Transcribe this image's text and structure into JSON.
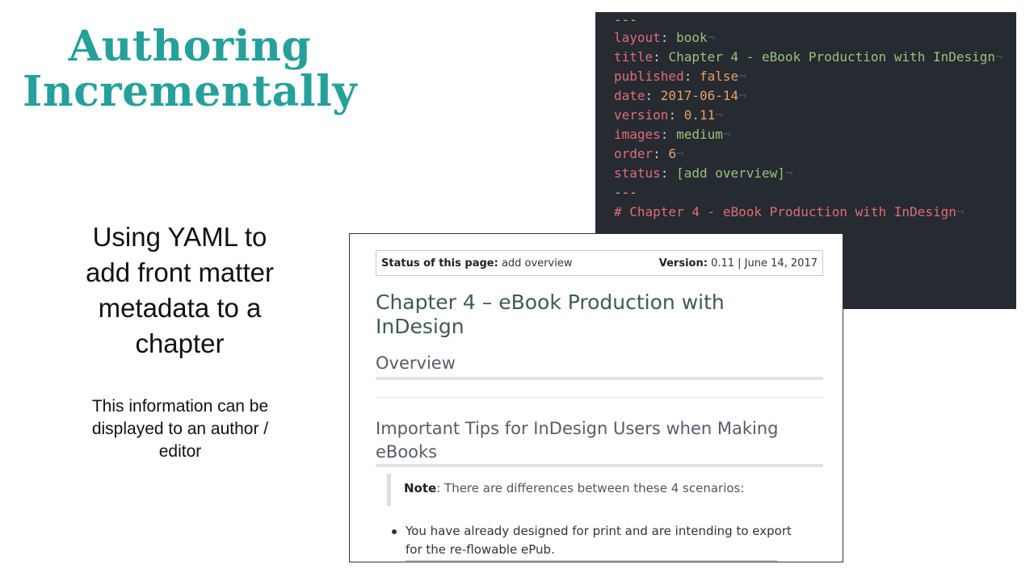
{
  "slide": {
    "title_line1": "Authoring",
    "title_line2": "Incrementally",
    "subtitle_line1": "Using YAML to",
    "subtitle_line2": "add front matter",
    "subtitle_line3": "metadata to a",
    "subtitle_line4": "chapter",
    "caption_line1": "This information can be",
    "caption_line2": "displayed to an author /",
    "caption_line3": "editor",
    "accent_color": "#26a09a"
  },
  "editor": {
    "delimiter": "---",
    "eol_marker": "¬",
    "lines": [
      {
        "key": "layout",
        "value": "book",
        "kind": "string"
      },
      {
        "key": "title",
        "value": "Chapter 4 - eBook Production with InDesign",
        "kind": "string"
      },
      {
        "key": "published",
        "value": "false",
        "kind": "number"
      },
      {
        "key": "date",
        "value": "2017-06-14",
        "kind": "number"
      },
      {
        "key": "version",
        "value": "0.11",
        "kind": "number"
      },
      {
        "key": "images",
        "value": "medium",
        "kind": "string"
      },
      {
        "key": "order",
        "value": "6",
        "kind": "number"
      },
      {
        "key": "status",
        "value": "[add overview]",
        "kind": "string"
      }
    ],
    "heading": "# Chapter 4 - eBook Production with InDesign",
    "background_color": "#262a31"
  },
  "page": {
    "status_label": "Status of this page:",
    "status_value": "add overview",
    "version_label": "Version:",
    "version_value": "0.11 | June 14, 2017",
    "chapter_title": "Chapter 4 – eBook Production with InDesign",
    "overview_heading": "Overview",
    "tips_heading": "Important Tips for InDesign Users when Making eBooks",
    "note_label": "Note",
    "note_text": ": There are differences between these 4 scenarios:",
    "bullet1": "You have already designed for print and are intending to export for the re-flowable ePub."
  }
}
